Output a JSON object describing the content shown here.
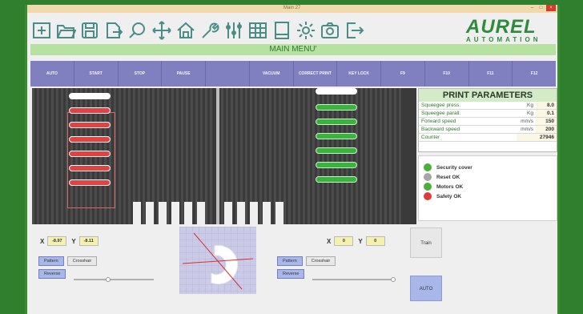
{
  "window": {
    "title": "Main 27",
    "minimize_glyph": "–",
    "maximize_glyph": "□",
    "close_glyph": "×"
  },
  "toolbar": {
    "icons": [
      "new-icon",
      "open-folder-icon",
      "save-icon",
      "export-icon",
      "search-icon",
      "move-icon",
      "home-icon",
      "tool-icon",
      "sliders-icon",
      "table-icon",
      "window-icon",
      "gear-icon",
      "camera-icon",
      "logout-icon"
    ]
  },
  "logo": {
    "brand": "AUREL",
    "sub": "AUTOMATION"
  },
  "menu": {
    "title": "MAIN MENU'"
  },
  "fkeys": [
    "AUTO",
    "START",
    "STOP",
    "PAUSE",
    "",
    "VACUUM",
    "CORRECT PRINT",
    "KEY LOCK",
    "F9",
    "F10",
    "F11",
    "F12"
  ],
  "print_params": {
    "title": "PRINT PARAMETERS",
    "rows": [
      {
        "label": "Squeegee press.",
        "unit": "Kg",
        "value": "8.0"
      },
      {
        "label": "Squeegee parall.",
        "unit": "Kg",
        "value": "0.1"
      },
      {
        "label": "Forward speed",
        "unit": "mm/s",
        "value": "150"
      },
      {
        "label": "Backward speed",
        "unit": "mm/s",
        "value": "200"
      },
      {
        "label": "Counter",
        "unit": "",
        "value": "27946"
      }
    ]
  },
  "status": [
    {
      "label": "Security cover",
      "color": "#4caf3a"
    },
    {
      "label": "Reset OK",
      "color": "#a5a5a5"
    },
    {
      "label": "Motors OK",
      "color": "#4caf3a"
    },
    {
      "label": "Safety OK",
      "color": "#e03a3a"
    }
  ],
  "left_controls": {
    "x_label": "X",
    "x_value": "-8.97",
    "y_label": "Y",
    "y_value": "-8.11",
    "pattern": "Pattern",
    "crosshair": "Crosshair",
    "reverse": "Reverse"
  },
  "right_controls": {
    "x_label": "X",
    "x_value": "0",
    "y_label": "Y",
    "y_value": "0",
    "pattern": "Pattern",
    "crosshair": "Crosshair",
    "reverse": "Reverse"
  },
  "side_buttons": {
    "train": "Train",
    "auto": "AUTO"
  }
}
